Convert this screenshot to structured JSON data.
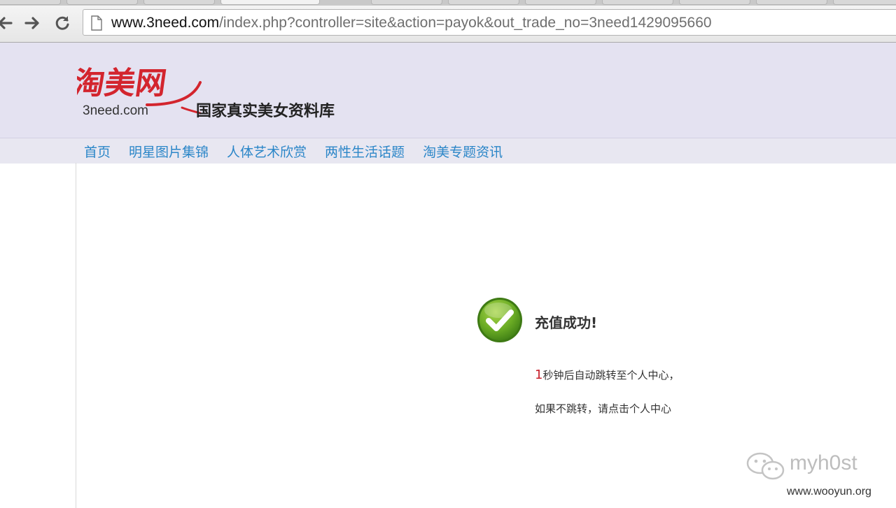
{
  "browser": {
    "address_bar": {
      "host": "www.3need.com",
      "path": "/index.php?controller=site&action=payok&out_trade_no=3need1429095660"
    },
    "icons": [
      "back-arrow-icon",
      "forward-arrow-icon",
      "reload-icon",
      "page-icon"
    ]
  },
  "site": {
    "logo_text": "淘美网",
    "logo_domain": "3need.com",
    "slogan": "国家真实美女资料库",
    "nav": [
      "首页",
      "明星图片集锦",
      "人体艺术欣赏",
      "两性生活话题",
      "淘美专题资讯"
    ]
  },
  "result": {
    "title": "充值成功!",
    "countdown": "1",
    "redirect_text": "秒钟后自动跳转至个人中心，",
    "manual_text": "如果不跳转，请点击个人中心",
    "icon": "checkmark-circle-icon"
  },
  "watermark": {
    "name": "myh0st",
    "site": "www.wooyun.org"
  },
  "colors": {
    "header_bg": "#e4e2f1",
    "nav_link": "#2b86c8",
    "logo_red": "#d3252e",
    "success_green": "#5a9a1f",
    "countdown_red": "#c8202c"
  }
}
